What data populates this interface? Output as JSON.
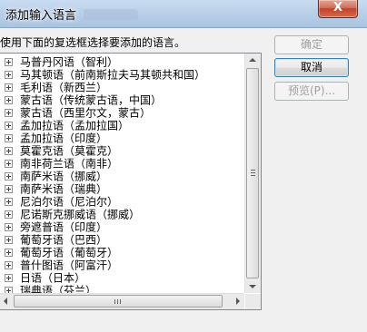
{
  "window": {
    "title": "添加输入语言",
    "close_glyph": "X"
  },
  "instruction": "使用下面的复选框选择要添加的语言。",
  "buttons": {
    "ok": "确定",
    "cancel": "取消",
    "preview": "预览(P)..."
  },
  "languages": [
    "马普丹冈语（智利）",
    "马其顿语（前南斯拉夫马其顿共和国）",
    "毛利语（新西兰）",
    "蒙古语（传统蒙古语，中国）",
    "蒙古语（西里尔文，蒙古）",
    "孟加拉语（孟加拉国）",
    "孟加拉语（印度）",
    "莫霍克语（莫霍克）",
    "南非荷兰语（南非）",
    "南萨米语（挪威）",
    "南萨米语（瑞典）",
    "尼泊尔语（尼泊尔）",
    "尼诺斯克挪威语（挪威）",
    "旁遮普语（印度）",
    "葡萄牙语（巴西）",
    "葡萄牙语（葡萄牙）",
    "普什图语（阿富汗）",
    "日语（日本）",
    "瑞典语（芬兰）"
  ]
}
